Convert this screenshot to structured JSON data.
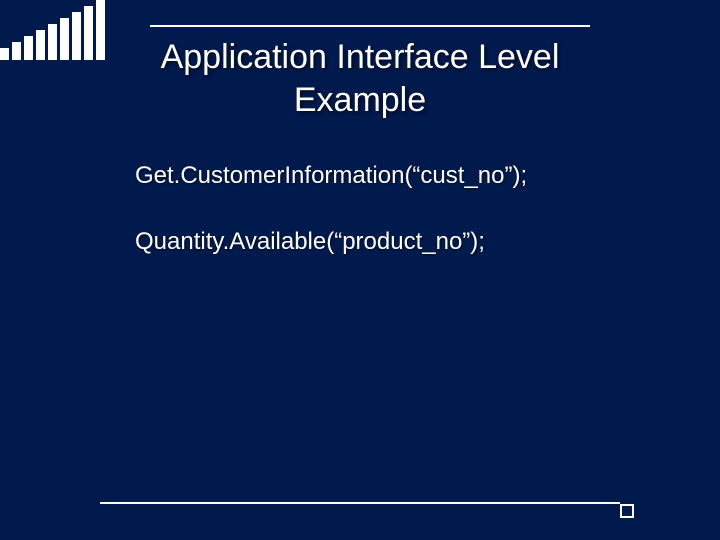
{
  "title_line1": "Application Interface Level",
  "title_line2": "Example",
  "body": {
    "line1": "Get.CustomerInformation(“cust_no”);",
    "line2": "Quantity.Available(“product_no”);"
  }
}
